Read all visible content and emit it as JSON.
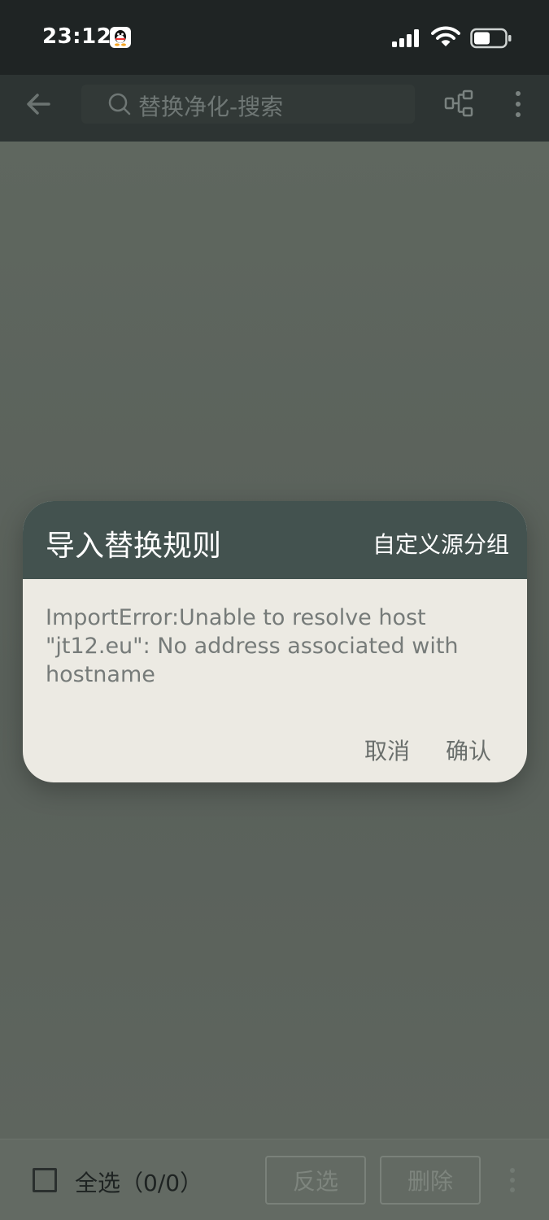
{
  "status_bar": {
    "time": "23:12",
    "icons": [
      "qq-icon",
      "signal-icon",
      "wifi-icon",
      "battery-icon"
    ]
  },
  "toolbar": {
    "back_icon": "arrow-left-icon",
    "search_placeholder": "替换净化-搜索",
    "group_icon": "group-tree-icon",
    "more_icon": "more-vertical-icon"
  },
  "dialog": {
    "title": "导入替换规则",
    "custom_group_label": "自定义源分组",
    "message": "ImportError:Unable to resolve host \"jt12.eu\": No address associated with hostname",
    "cancel_label": "取消",
    "confirm_label": "确认"
  },
  "bottom_bar": {
    "select_all_label": "全选（0/0）",
    "invert_label": "反选",
    "delete_label": "删除"
  },
  "colors": {
    "dialog_header": "#43524f",
    "dialog_body": "#eceae3",
    "scrim": "#5f665f"
  }
}
